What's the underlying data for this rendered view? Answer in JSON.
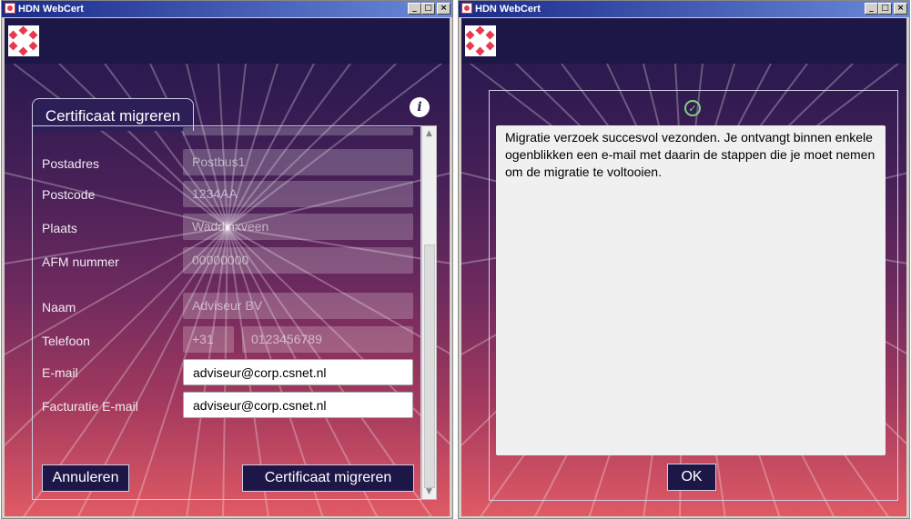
{
  "left_window": {
    "title": "HDN WebCert",
    "tab_label": "Certificaat migreren",
    "info_icon_glyph": "i",
    "fields": [
      {
        "label": "Postadres",
        "value": "Postbus1"
      },
      {
        "label": "Postcode",
        "value": "1234AA"
      },
      {
        "label": "Plaats",
        "value": "Waddinxveen"
      },
      {
        "label": "AFM nummer",
        "value": "00000000"
      },
      {
        "label": "Naam",
        "value": "Adviseur BV"
      },
      {
        "label": "Telefoon",
        "prefix": "+31",
        "value": "0123456789"
      },
      {
        "label": "E-mail",
        "value": "adviseur@corp.csnet.nl"
      },
      {
        "label": "Facturatie E-mail",
        "value": "adviseur@corp.csnet.nl"
      }
    ],
    "cancel_label": "Annuleren",
    "submit_label": "Certificaat migreren"
  },
  "right_window": {
    "title": "HDN WebCert",
    "message": "Migratie verzoek succesvol vezonden. Je ontvangt binnen enkele ogenblikken een e-mail met daarin de stappen die je moet nemen om de migratie te voltooien.",
    "ok_label": "OK"
  },
  "window_buttons": {
    "minimize": "_",
    "maximize": "□",
    "close": "×"
  },
  "colors": {
    "accent": "#e53a4f",
    "header_bg": "#1d1747",
    "button_bg": "#1d1747",
    "success": "#7fd17f"
  }
}
